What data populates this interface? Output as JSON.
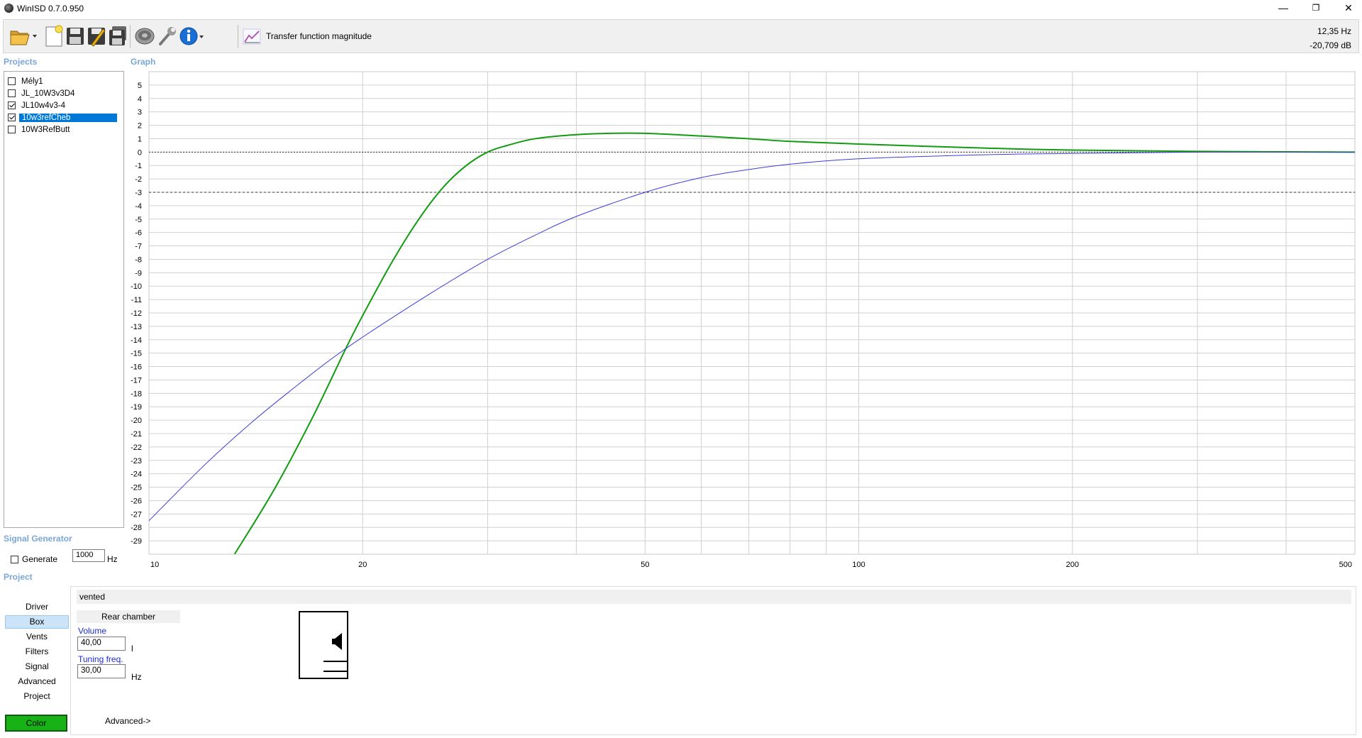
{
  "window": {
    "title": "WinISD 0.7.0.950",
    "minimize": "—",
    "restore": "❐",
    "close": "✕"
  },
  "toolbar": {
    "graph_type": "Transfer function magnitude",
    "readout_freq": "12,35 Hz",
    "readout_db": "-20,709 dB"
  },
  "sections": {
    "projects": "Projects",
    "graph": "Graph",
    "signal_generator": "Signal Generator",
    "project": "Project"
  },
  "projects": [
    {
      "name": "Mély1",
      "checked": false,
      "selected": false
    },
    {
      "name": "JL_10W3v3D4",
      "checked": false,
      "selected": false
    },
    {
      "name": "JL10w4v3-4",
      "checked": true,
      "selected": false
    },
    {
      "name": "10w3refCheb",
      "checked": true,
      "selected": true
    },
    {
      "name": "10W3RefButt",
      "checked": false,
      "selected": false
    }
  ],
  "signal_generator": {
    "generate_label": "Generate",
    "generate_checked": false,
    "frequency": "1000",
    "unit": "Hz"
  },
  "project_nav": {
    "items": [
      "Driver",
      "Box",
      "Vents",
      "Filters",
      "Signal",
      "Advanced",
      "Project"
    ],
    "selected": "Box",
    "color_button": "Color"
  },
  "box": {
    "type": "vented",
    "rear_chamber": "Rear chamber",
    "volume_label": "Volume",
    "volume_value": "40,00",
    "volume_unit": "l",
    "tuning_label": "Tuning freq.",
    "tuning_value": "30,00",
    "tuning_unit": "Hz",
    "advanced": "Advanced->"
  },
  "colors": {
    "series_green": "#109c10",
    "series_blue": "#3c3cdc",
    "section_header": "#7aa6d8",
    "selection": "#0078d7"
  },
  "chart_data": {
    "type": "line",
    "x_scale": "log",
    "xlim": [
      10,
      500
    ],
    "ylim": [
      -30,
      6
    ],
    "x_tick_labels": [
      10,
      20,
      50,
      100,
      200,
      500
    ],
    "x_gridlines": [
      20,
      30,
      40,
      50,
      60,
      70,
      80,
      90,
      100,
      200,
      300,
      400
    ],
    "y_ticks": [
      5,
      4,
      3,
      2,
      1,
      0,
      -1,
      -2,
      -3,
      -4,
      -5,
      -6,
      -7,
      -8,
      -9,
      -10,
      -11,
      -12,
      -13,
      -14,
      -15,
      -16,
      -17,
      -18,
      -19,
      -20,
      -21,
      -22,
      -23,
      -24,
      -25,
      -26,
      -27,
      -28,
      -29
    ],
    "reference_lines": [
      {
        "y": 0,
        "style": "dotted"
      },
      {
        "y": -3,
        "style": "dashed"
      }
    ],
    "grid": true,
    "series": [
      {
        "color": "#109c10",
        "stroke": 2,
        "x": [
          13.2,
          15,
          17,
          19,
          20,
          22,
          24,
          26,
          28,
          30,
          32,
          35,
          40,
          45,
          50,
          60,
          70,
          80,
          100,
          150,
          200,
          300,
          500
        ],
        "y": [
          -30,
          -25.2,
          -19.8,
          -14.5,
          -12.2,
          -8.2,
          -5,
          -2.6,
          -1,
          0,
          0.5,
          1,
          1.3,
          1.4,
          1.4,
          1.2,
          1.0,
          0.8,
          0.6,
          0.3,
          0.15,
          0.05,
          0
        ]
      },
      {
        "color": "#3c3cdc",
        "stroke": 1,
        "x": [
          10,
          12,
          14,
          16,
          18,
          20,
          25,
          30,
          35,
          40,
          50,
          60,
          70,
          80,
          100,
          150,
          200,
          300,
          500
        ],
        "y": [
          -27.5,
          -23.3,
          -20.1,
          -17.6,
          -15.5,
          -13.8,
          -10.5,
          -8,
          -6.2,
          -4.8,
          -3,
          -1.9,
          -1.3,
          -0.9,
          -0.5,
          -0.2,
          -0.1,
          0,
          0
        ]
      }
    ]
  }
}
